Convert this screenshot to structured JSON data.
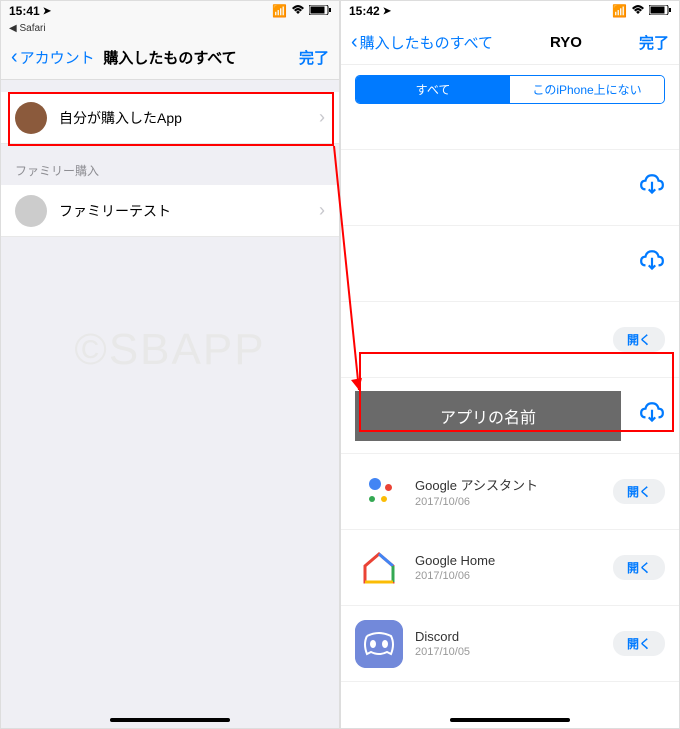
{
  "watermark": "©SBAPP",
  "left": {
    "status": {
      "time": "15:41",
      "safari_back": "◀ Safari"
    },
    "nav": {
      "back": "アカウント",
      "title": "購入したものすべて",
      "done": "完了"
    },
    "rows": {
      "my_purchases": "自分が購入したApp",
      "family_header": "ファミリー購入",
      "family_member": "ファミリーテスト"
    }
  },
  "right": {
    "status": {
      "time": "15:42"
    },
    "nav": {
      "back": "購入したものすべて",
      "title": "RYO",
      "done": "完了"
    },
    "segments": {
      "all": "すべて",
      "not_on_device": "このiPhone上にない"
    },
    "masked_label": "アプリの名前",
    "open_label": "開く",
    "apps": [
      {
        "name": "Google アシスタント",
        "date": "2017/10/06",
        "action": "open",
        "icon": "ga"
      },
      {
        "name": "Google Home",
        "date": "2017/10/06",
        "action": "open",
        "icon": "gh"
      },
      {
        "name": "Discord",
        "date": "2017/10/05",
        "action": "open",
        "icon": "dc"
      }
    ]
  }
}
